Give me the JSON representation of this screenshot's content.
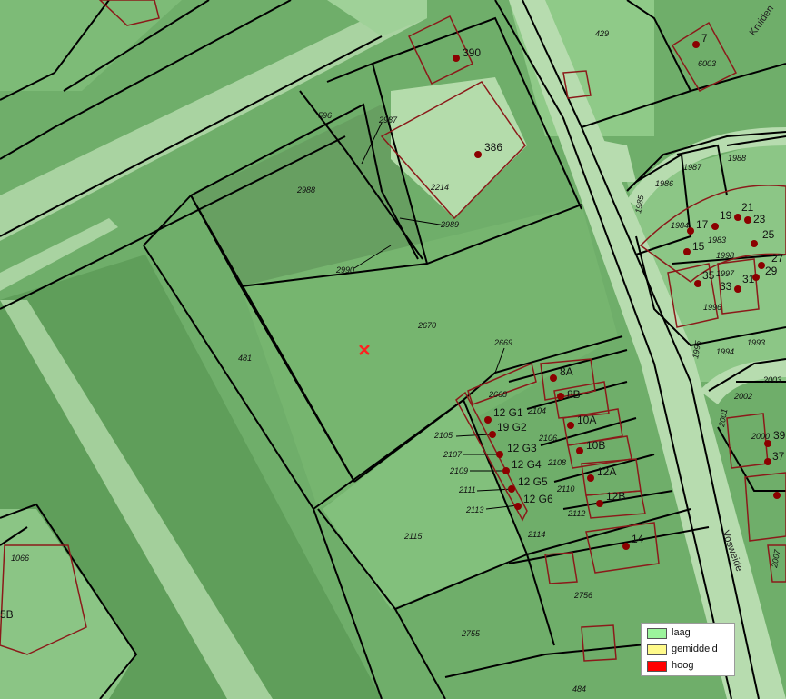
{
  "map": {
    "parcels": [
      "429",
      "390",
      "386",
      "596",
      "2987",
      "2988",
      "2214",
      "2989",
      "2990",
      "2670",
      "2669",
      "481",
      "2668",
      "2104",
      "2105",
      "2106",
      "2107",
      "2108",
      "2109",
      "2110",
      "2111",
      "2112",
      "2113",
      "2114",
      "2115",
      "1066",
      "2756",
      "2755",
      "484",
      "1987",
      "1988",
      "1986",
      "1985",
      "1984",
      "1983",
      "1998",
      "1997",
      "1996",
      "1994",
      "1993",
      "1995",
      "2003",
      "2002",
      "2001",
      "2000",
      "2007",
      "6003"
    ],
    "house_numbers": [
      "390",
      "386",
      "7",
      "8A",
      "8B",
      "10A",
      "10B",
      "12A",
      "12B",
      "14",
      "12 G1",
      "19 G2",
      "12 G3",
      "12 G4",
      "12 G5",
      "12 G6",
      "17",
      "19",
      "21",
      "23",
      "25",
      "27",
      "29",
      "31",
      "33",
      "35",
      "15",
      "39",
      "37",
      "5B"
    ],
    "streets": [
      "Vosweide",
      "Kruiden"
    ],
    "marker": "selected-location-cross"
  },
  "legend": {
    "items": [
      {
        "label": "laag",
        "color": "#9cf49c"
      },
      {
        "label": "gemiddeld",
        "color": "#fffa8a"
      },
      {
        "label": "hoog",
        "color": "#ff0000"
      }
    ]
  },
  "colors": {
    "base": "#6fae6a",
    "light": "#b9deb2",
    "road": "#cfe8c8",
    "parcel_line": "#000000",
    "building_line": "#8b1a1a",
    "dot": "#8b0000",
    "marker": "#ff2020"
  }
}
